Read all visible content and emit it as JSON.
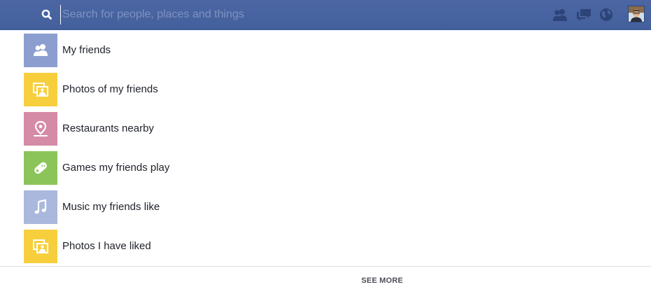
{
  "search": {
    "placeholder": "Search for people, places and things",
    "value": ""
  },
  "topbar": {
    "background": "#4a64a2",
    "icons": [
      "friend-requests-icon",
      "messages-icon",
      "notifications-globe-icon"
    ]
  },
  "suggestions": [
    {
      "label": "My friends",
      "icon": "friends-icon",
      "color": "#8c9ed0"
    },
    {
      "label": "Photos of my friends",
      "icon": "photos-icon",
      "color": "#f7cf3d"
    },
    {
      "label": "Restaurants nearby",
      "icon": "map-pin-icon",
      "color": "#d58aa6"
    },
    {
      "label": "Games my friends play",
      "icon": "game-controller-icon",
      "color": "#8bc55a"
    },
    {
      "label": "Music my friends like",
      "icon": "music-note-icon",
      "color": "#a9b8dc"
    },
    {
      "label": "Photos I have liked",
      "icon": "photos-icon",
      "color": "#f7cf3d"
    }
  ],
  "footer": {
    "see_more_label": "SEE MORE"
  }
}
